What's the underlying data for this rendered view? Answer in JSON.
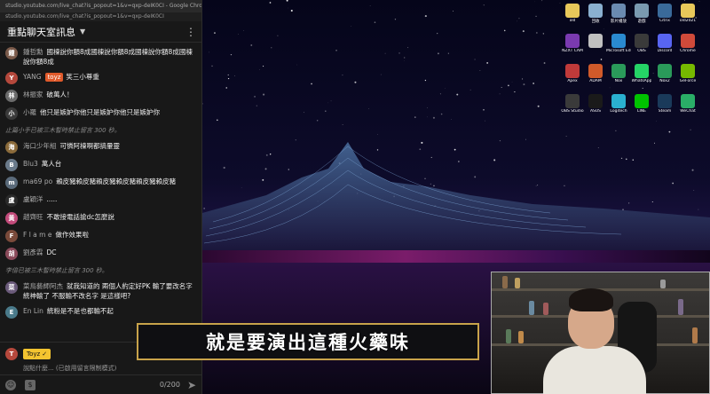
{
  "window": {
    "url": "studio.youtube.com/live_chat?is_popout=1&v=qxp-deIK0CI - Google Chrome",
    "url_short": "studio.youtube.com/live_chat?is_popout=1&v=qxp-deIK0CI"
  },
  "chat": {
    "title": "重點聊天室訊息",
    "messages": [
      {
        "avatar_letter": "鍾",
        "avatar_color": "#7a5a4a",
        "author": "鍾哲勳",
        "badge": "",
        "text": "國棟說你額8成國棟說你額8成國棟說你額8成國棟說你額8成"
      },
      {
        "avatar_letter": "Y",
        "avatar_color": "#b5483c",
        "author": "YANG",
        "badge": "toyz",
        "text": "笑三小尊重"
      },
      {
        "avatar_letter": "林",
        "avatar_color": "#6b6b6b",
        "author": "林振家",
        "badge": "",
        "text": "破萬人！"
      },
      {
        "avatar_letter": "小",
        "avatar_color": "#3a3a3a",
        "author": "小羅",
        "badge": "",
        "text": "他只是嫉妒你他只是嫉妒你他只是嫉妒你"
      }
    ],
    "system_1": "止篇小手已被三木暫時禁止留言 300 秒。",
    "messages_2": [
      {
        "avatar_letter": "海",
        "avatar_color": "#8a6a3a",
        "author": "海口少年組",
        "badge": "",
        "text": "可憐阿棟啊都搞暈靈"
      },
      {
        "avatar_letter": "B",
        "avatar_color": "#6a7a8a",
        "author": "Blu3",
        "badge": "",
        "text": "萬人台"
      },
      {
        "avatar_letter": "m",
        "avatar_color": "#5a6a7a",
        "author": "ma69 po",
        "badge": "",
        "text": "賴皮豬賴皮豬賴皮豬賴皮豬賴皮豬賴皮豬"
      },
      {
        "avatar_letter": "盧",
        "avatar_color": "#2a2a2a",
        "author": "盧穎洋",
        "badge": "",
        "text": "....."
      },
      {
        "avatar_letter": "黃",
        "avatar_color": "#c24a7a",
        "author": "趙齊旺",
        "badge": "",
        "text": "不敢接電話搶dc怎麼說"
      },
      {
        "avatar_letter": "F",
        "avatar_color": "#7a4a3a",
        "author": "F l a m e",
        "badge": "",
        "text": "做作效果啦"
      },
      {
        "avatar_letter": "胡",
        "avatar_color": "#8a4a5a",
        "author": "劉彥霖",
        "badge": "",
        "text": "DC"
      }
    ],
    "system_2": "李倍已被三木暫時禁止留言 300 秒。",
    "messages_3": [
      {
        "avatar_letter": "菜",
        "avatar_color": "#6a5a7a",
        "author": "菜鳥藝師阿杰",
        "badge": "",
        "text": "就我知道的 兩個人約定好PK 輸了要改名字 統神輸了 不服輸不改名字 是這樣吧?"
      },
      {
        "avatar_letter": "E",
        "avatar_color": "#4a7a8a",
        "author": "En Lin",
        "badge": "",
        "text": "統粉是不是也都輸不起"
      }
    ],
    "pinned": {
      "author": "Toyz",
      "check": "✓",
      "input_placeholder": "說點什麼... (已啟用留言限制模式)"
    },
    "counter": "0/200"
  },
  "desktop_icons": [
    {
      "name": "old",
      "color": "#e8c85a"
    },
    {
      "name": "回收",
      "color": "#8ab0d0"
    },
    {
      "name": "影片播放",
      "color": "#6a8ab0"
    },
    {
      "name": "遊戲",
      "color": "#7a9ab0"
    },
    {
      "name": "Citrix",
      "color": "#3a6a9a"
    },
    {
      "name": "old2021",
      "color": "#e8c85a"
    },
    {
      "name": "NZXT CAM",
      "color": "#7a3ab0"
    },
    {
      "name": "",
      "color": "#c0c0c0"
    },
    {
      "name": "Microsoft Edge",
      "color": "#2a8ad0"
    },
    {
      "name": "OBS",
      "color": "#3a3a3a"
    },
    {
      "name": "Discord",
      "color": "#5865f2"
    },
    {
      "name": "Chrome",
      "color": "#d04a3a"
    },
    {
      "name": "Apex",
      "color": "#c03a3a"
    },
    {
      "name": "ADAM",
      "color": "#d05a2a"
    },
    {
      "name": "Nox",
      "color": "#2a9a5a"
    },
    {
      "name": "WhatsApp",
      "color": "#25d366"
    },
    {
      "name": "Nox2",
      "color": "#2a9a5a"
    },
    {
      "name": "GeForce",
      "color": "#76b900"
    },
    {
      "name": "OBS Studio",
      "color": "#3a3a3a"
    },
    {
      "name": "ASUS",
      "color": "#1a1a1a"
    },
    {
      "name": "Logitech",
      "color": "#2ab0d0"
    },
    {
      "name": "LINE",
      "color": "#00c300"
    },
    {
      "name": "Steam",
      "color": "#1a3a5a"
    },
    {
      "name": "WeChat",
      "color": "#2aae67"
    }
  ],
  "overlay": {
    "subtitle": "就是要演出這種火藥味"
  }
}
